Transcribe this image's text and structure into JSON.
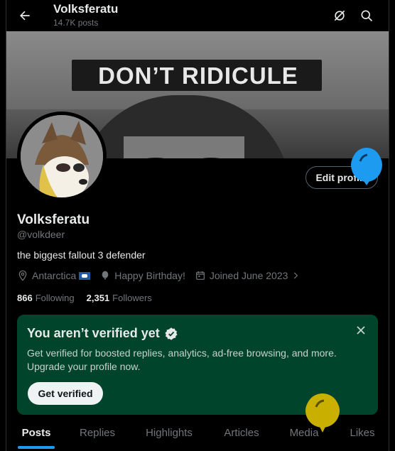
{
  "header": {
    "title": "Volksferatu",
    "posts_count": "14.7K posts"
  },
  "banner": {
    "sign_text": "DON’T RIDICULE"
  },
  "profile": {
    "display_name": "Volksferatu",
    "handle": "@volkdeer",
    "bio": "the biggest fallout 3 defender",
    "location": "Antarctica",
    "birthday": "Happy Birthday!",
    "joined": "Joined June 2023",
    "following_count": "866",
    "following_label": "Following",
    "followers_count": "2,351",
    "followers_label": "Followers",
    "edit_label": "Edit profile"
  },
  "verify_card": {
    "title": "You aren’t verified yet",
    "description": "Get verified for boosted replies, analytics, ad-free browsing, and more. Upgrade your profile now.",
    "button_label": "Get verified"
  },
  "tabs": [
    {
      "label": "Posts"
    },
    {
      "label": "Replies"
    },
    {
      "label": "Highlights"
    },
    {
      "label": "Articles"
    },
    {
      "label": "Media"
    },
    {
      "label": "Likes"
    }
  ],
  "colors": {
    "accent": "#1d9bf0",
    "verify_bg": "#00452b",
    "balloon_blue": "#1d9bf0",
    "balloon_yellow": "#c9b000"
  },
  "icons": [
    "back-arrow-icon",
    "grok-icon",
    "search-icon",
    "location-pin-icon",
    "balloon-icon",
    "calendar-icon",
    "chevron-right-icon",
    "verified-badge-icon",
    "close-icon"
  ]
}
